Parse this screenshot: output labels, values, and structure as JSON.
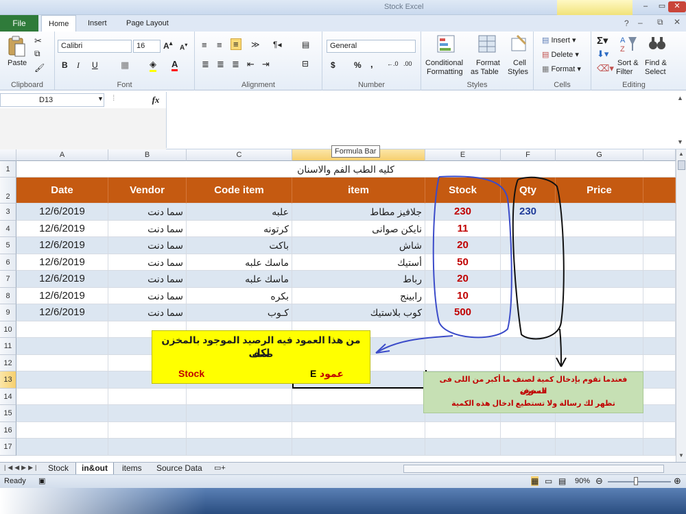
{
  "window": {
    "title": "Stock Excel",
    "controls": {
      "minimize": "–",
      "maximize": "▭",
      "close": "✕"
    }
  },
  "ribbon_tabs": {
    "file": "File",
    "home": "Home",
    "insert": "Insert",
    "page_layout": "Page Layout"
  },
  "ribbon": {
    "clipboard": {
      "label": "Clipboard",
      "paste": "Paste"
    },
    "font": {
      "label": "Font",
      "name": "Calibri",
      "size": "16",
      "bold": "B",
      "italic": "I",
      "underline": "U"
    },
    "alignment": {
      "label": "Alignment"
    },
    "number": {
      "label": "Number",
      "format": "General",
      "currency": "$",
      "percent": "%",
      "comma": ","
    },
    "styles": {
      "label": "Styles",
      "conditional": "Conditional",
      "conditional2": "Formatting",
      "format_as": "Format",
      "format_as2": "as Table",
      "cell": "Cell",
      "cell2": "Styles"
    },
    "cells": {
      "label": "Cells",
      "insert": "Insert",
      "delete": "Delete",
      "format": "Format"
    },
    "editing": {
      "label": "Editing",
      "sort": "Sort &",
      "sort2": "Filter",
      "find": "Find &",
      "find2": "Select"
    }
  },
  "formula_bar": {
    "name_box": "D13",
    "fx": "fx",
    "tooltip": "Formula Bar"
  },
  "columns": [
    "A",
    "B",
    "C",
    "D",
    "E",
    "F",
    "G"
  ],
  "rows": [
    "1",
    "2",
    "3",
    "4",
    "5",
    "6",
    "7",
    "8",
    "9",
    "10",
    "11",
    "12",
    "13",
    "14",
    "15",
    "16",
    "17"
  ],
  "sheet": {
    "title": "كليه الطب الفم والاسنان",
    "headers": {
      "date": "Date",
      "vendor": "Vendor",
      "code": "Code item",
      "item": "item",
      "stock": "Stock",
      "qty": "Qty",
      "price": "Price"
    },
    "data": [
      {
        "date": "12/6/2019",
        "vendor": "سما دنت",
        "code": "علبه",
        "item": "جلافيز مطاط",
        "stock": "230",
        "qty": "230"
      },
      {
        "date": "12/6/2019",
        "vendor": "سما دنت",
        "code": "كرتونه",
        "item": "نايكن صوانى",
        "stock": "11",
        "qty": ""
      },
      {
        "date": "12/6/2019",
        "vendor": "سما دنت",
        "code": "باكت",
        "item": "شاش",
        "stock": "20",
        "qty": ""
      },
      {
        "date": "12/6/2019",
        "vendor": "سما دنت",
        "code": "ماسك  علبه",
        "item": "أستيك",
        "stock": "50",
        "qty": ""
      },
      {
        "date": "12/6/2019",
        "vendor": "سما دنت",
        "code": "ماسك  علبه",
        "item": "رباط",
        "stock": "20",
        "qty": ""
      },
      {
        "date": "12/6/2019",
        "vendor": "سما دنت",
        "code": "بكره",
        "item": "رابينج",
        "stock": "10",
        "qty": ""
      },
      {
        "date": "12/6/2019",
        "vendor": "سما دنت",
        "code": "كـوب",
        "item": "كوب بلاستيك",
        "stock": "500",
        "qty": ""
      }
    ]
  },
  "annotations": {
    "yellow_line1": "من هذا العمود فيه الرصيد الموجود بالمخزن لكل",
    "yellow_line2": "صنف",
    "yellow_stock": "Stock",
    "yellow_col_label": "عمود",
    "yellow_col_letter": "E",
    "green_line1": "فعندما تقوم بإدخال كمية لصنف ما أكبر من اللى فى المخزن",
    "green_line2": "فسوف",
    "green_line3": "تظهر لك رسالة ولا تستطيع ادخال هذه الكمية"
  },
  "sheet_tabs": [
    "Stock",
    "in&out",
    "items",
    "Source Data"
  ],
  "active_sheet": "in&out",
  "status": {
    "ready": "Ready",
    "zoom": "90%"
  },
  "colors": {
    "header_fill": "#c55a11",
    "band_fill": "#dce6f1",
    "stock_red": "#c00000",
    "qty_blue": "#1f3b99",
    "file_tab": "#2f7b3a"
  }
}
